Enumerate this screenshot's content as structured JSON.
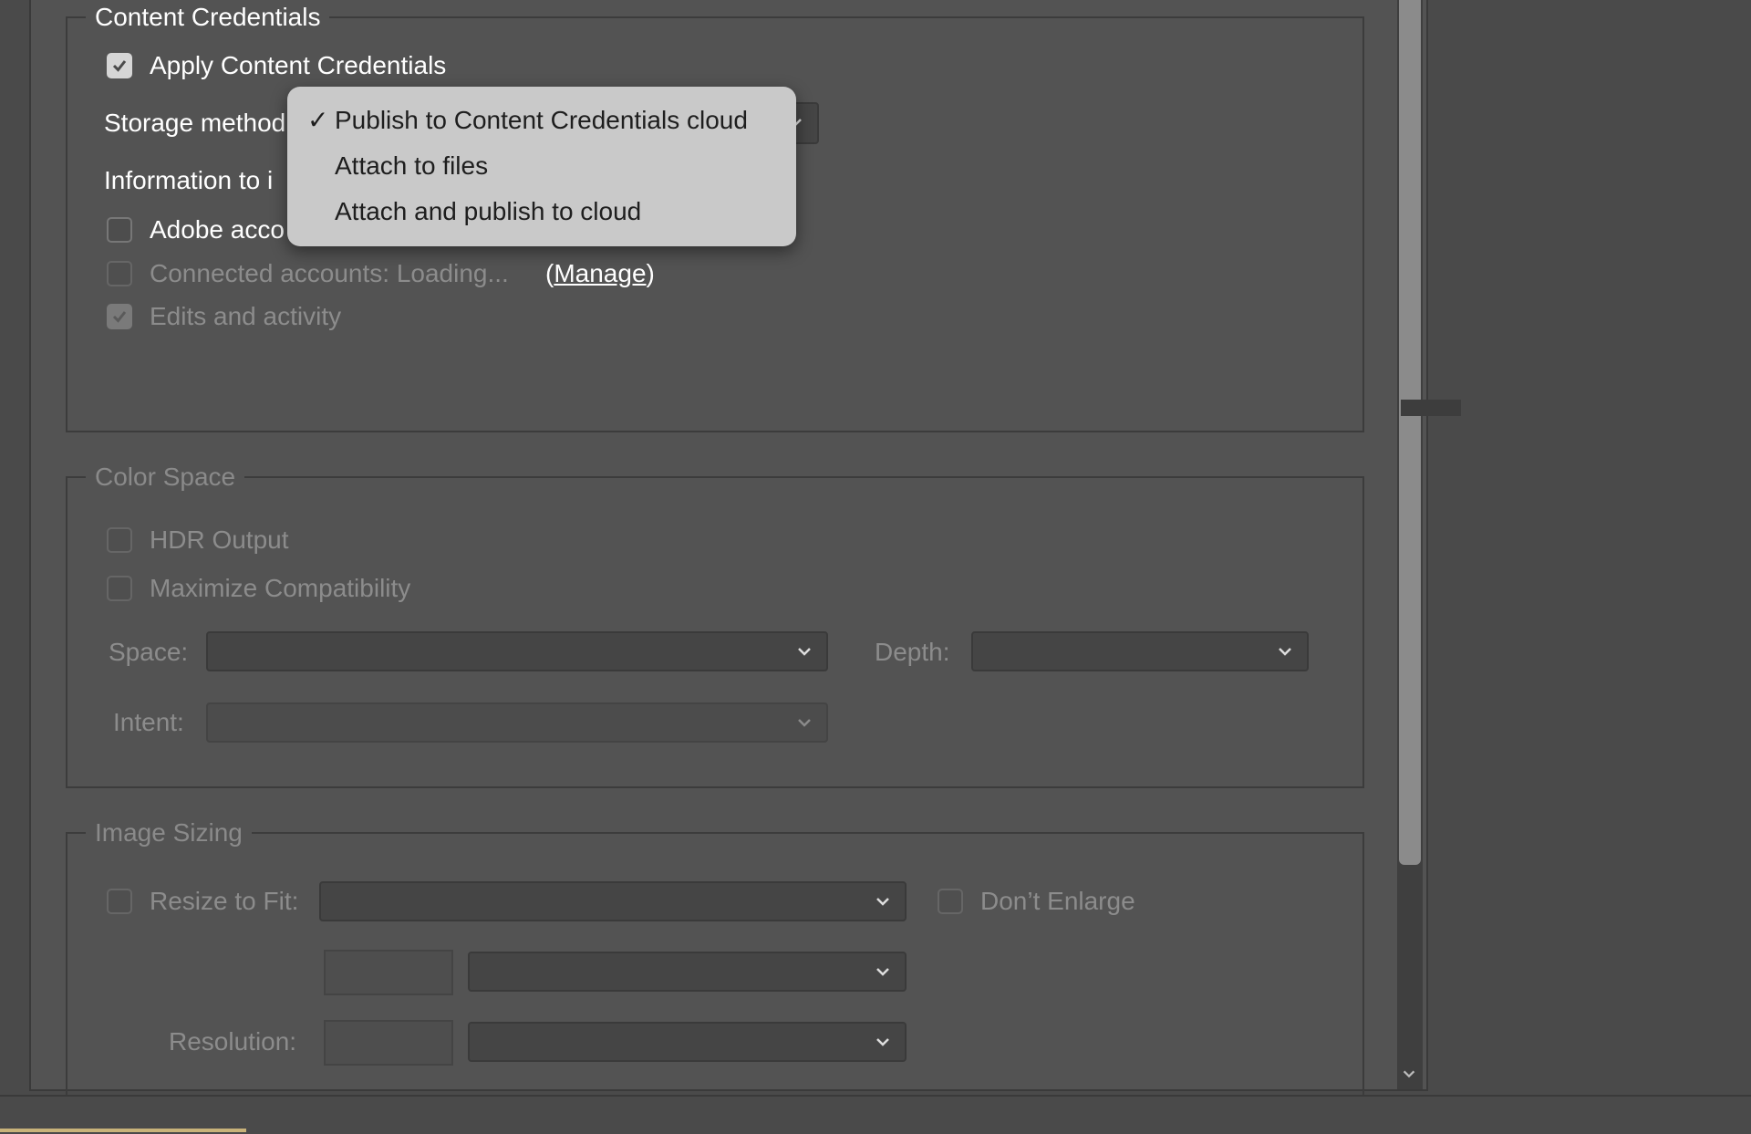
{
  "content_credentials": {
    "legend": "Content Credentials",
    "apply_label": "Apply Content Credentials",
    "storage_method_label": "Storage method",
    "information_label": "Information to i",
    "adobe_account_label": "Adobe acco",
    "connected_accounts_label": "Connected accounts: Loading...",
    "manage_open": "(",
    "manage_link": "Manage",
    "manage_close": ")",
    "edits_activity_label": "Edits and activity"
  },
  "storage_menu": {
    "check_glyph": "✓",
    "options": [
      "Publish to Content Credentials cloud",
      "Attach to files",
      "Attach and publish to cloud"
    ],
    "selected_index": 0
  },
  "color_space": {
    "legend": "Color Space",
    "hdr_label": "HDR Output",
    "maximize_label": "Maximize Compatibility",
    "space_label": "Space:",
    "depth_label": "Depth:",
    "intent_label": "Intent:"
  },
  "image_sizing": {
    "legend": "Image Sizing",
    "resize_label": "Resize to Fit:",
    "dont_enlarge_label": "Don’t Enlarge",
    "resolution_label": "Resolution:"
  },
  "colors": {
    "panel": "#535353",
    "menu": "#c9c9c9",
    "scroll_thumb": "#8b8b8b"
  }
}
